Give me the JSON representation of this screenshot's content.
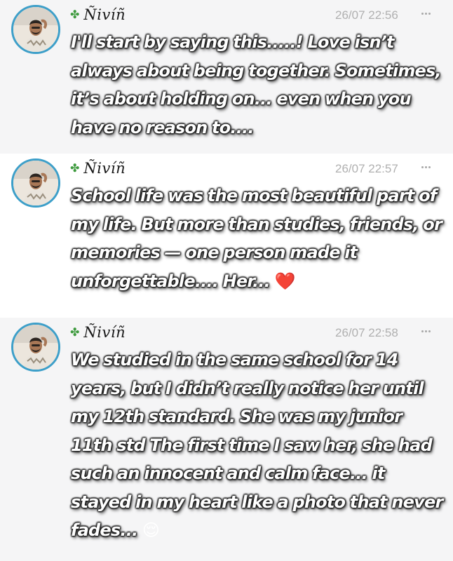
{
  "posts": [
    {
      "author": "Ñivíñ",
      "author_icon": "four-leaf-clover-icon",
      "timestamp": "26/07 22:56",
      "text": "I'll start by saying this.....! Love isn’t always about being together. Sometimes, it’s about holding on... even when you have no reason to....",
      "emoji": ""
    },
    {
      "author": "Ñivíñ",
      "author_icon": "four-leaf-clover-icon",
      "timestamp": "26/07 22:57",
      "text": "School life was the most beautiful part of my life. But more than studies, friends, or memories — one person made it unforgettable.... Her...",
      "emoji": "❤️"
    },
    {
      "author": "Ñivíñ",
      "author_icon": "four-leaf-clover-icon",
      "timestamp": "26/07 22:58",
      "text": "We studied in the same school for 14 years, but I didn’t really notice her until my 12th standard. She was my junior 11th std The first time I saw her, she had such an innocent and calm face... it stayed in my heart like a photo that never fades...",
      "emoji": "😌"
    }
  ],
  "colors": {
    "shaded_background": "#f5f5f6",
    "avatar_ring": "#3d9fc9",
    "timestamp": "#b0b0b0"
  }
}
